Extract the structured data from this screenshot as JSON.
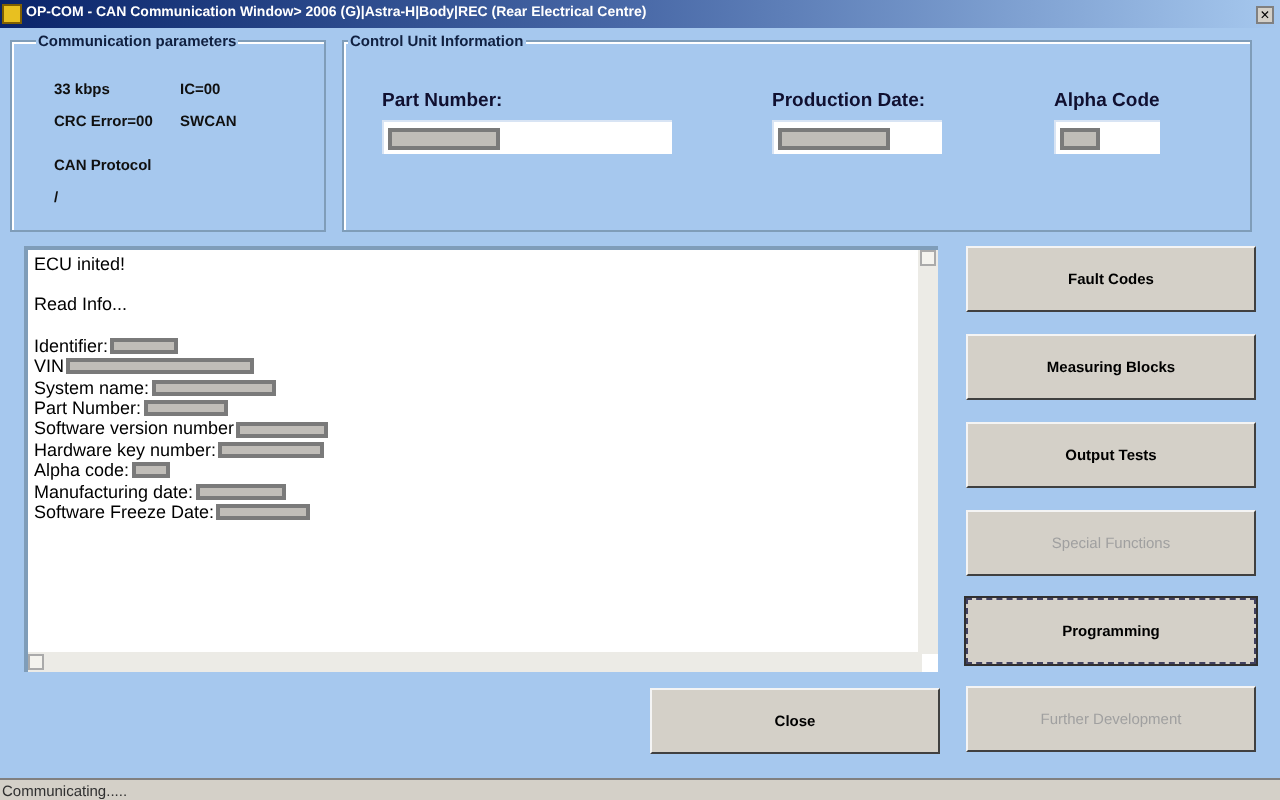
{
  "window": {
    "title": "OP-COM - CAN Communication Window> 2006 (G)|Astra-H|Body|REC (Rear Electrical Centre)",
    "close": "×"
  },
  "communication_parameters": {
    "title": "Communication parameters",
    "items": [
      "33 kbps",
      "IC=00",
      "CRC Error=00",
      "SWCAN",
      "CAN Protocol",
      "/"
    ]
  },
  "control_unit_information": {
    "title": "Control Unit Information",
    "fields": [
      {
        "label": "Part Number:"
      },
      {
        "label": "Production Date:"
      },
      {
        "label": "Alpha Code"
      }
    ]
  },
  "log": [
    {
      "kind": "message",
      "text": "ECU inited!"
    },
    {
      "kind": "message",
      "text": "Read Info..."
    },
    {
      "kind": "field",
      "text": "Identifier:"
    },
    {
      "kind": "field",
      "text": "VIN"
    },
    {
      "kind": "field",
      "text": "System name:"
    },
    {
      "kind": "field",
      "text": "Part Number:"
    },
    {
      "kind": "field",
      "text": "Software version number"
    },
    {
      "kind": "field",
      "text": "Hardware key number:"
    },
    {
      "kind": "field",
      "text": "Alpha code:"
    },
    {
      "kind": "field",
      "text": "Manufacturing date:"
    },
    {
      "kind": "field",
      "text": "Software Freeze Date:"
    }
  ],
  "buttons": [
    {
      "label": "Fault Codes",
      "disabled": false,
      "focused": false
    },
    {
      "label": "Measuring Blocks",
      "disabled": false,
      "focused": false
    },
    {
      "label": "Output Tests",
      "disabled": false,
      "focused": false
    },
    {
      "label": "Special Functions",
      "disabled": true,
      "focused": false
    },
    {
      "label": "Programming",
      "disabled": false,
      "focused": true
    },
    {
      "label": "Further Development",
      "disabled": true,
      "focused": false
    }
  ],
  "close_button": {
    "label": "Close"
  },
  "status_bar": {
    "text": "Communicating....."
  }
}
